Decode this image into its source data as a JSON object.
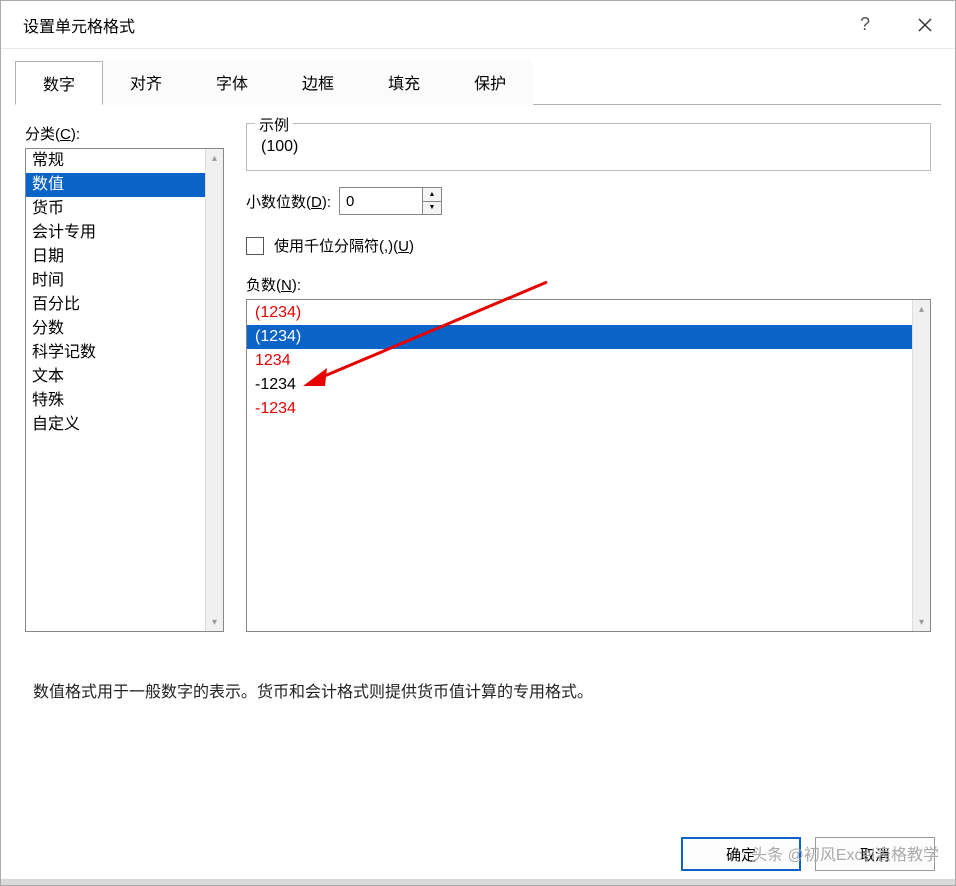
{
  "dialog": {
    "title": "设置单元格格式"
  },
  "tabs": [
    "数字",
    "对齐",
    "字体",
    "边框",
    "填充",
    "保护"
  ],
  "category": {
    "label_prefix": "分类(",
    "label_hotkey": "C",
    "label_suffix": "):",
    "items": [
      "常规",
      "数值",
      "货币",
      "会计专用",
      "日期",
      "时间",
      "百分比",
      "分数",
      "科学记数",
      "文本",
      "特殊",
      "自定义"
    ],
    "selected_index": 1
  },
  "sample": {
    "legend": "示例",
    "value": "(100)"
  },
  "decimals": {
    "label_prefix": "小数位数(",
    "label_hotkey": "D",
    "label_suffix": "):",
    "value": "0"
  },
  "thousands": {
    "label_prefix": "使用千位分隔符(,)(",
    "label_hotkey": "U",
    "label_suffix": ")"
  },
  "negative": {
    "label_prefix": "负数(",
    "label_hotkey": "N",
    "label_suffix": "):",
    "items": [
      {
        "text": "(1234)",
        "red": true
      },
      {
        "text": "(1234)",
        "red": false
      },
      {
        "text": "1234",
        "red": true
      },
      {
        "text": "-1234",
        "red": false
      },
      {
        "text": "-1234",
        "red": true
      }
    ],
    "selected_index": 1
  },
  "description": "数值格式用于一般数字的表示。货币和会计格式则提供货币值计算的专用格式。",
  "footer": {
    "ok": "确定",
    "cancel": "取消",
    "watermark": "头条 @初风Excel表格教学"
  }
}
